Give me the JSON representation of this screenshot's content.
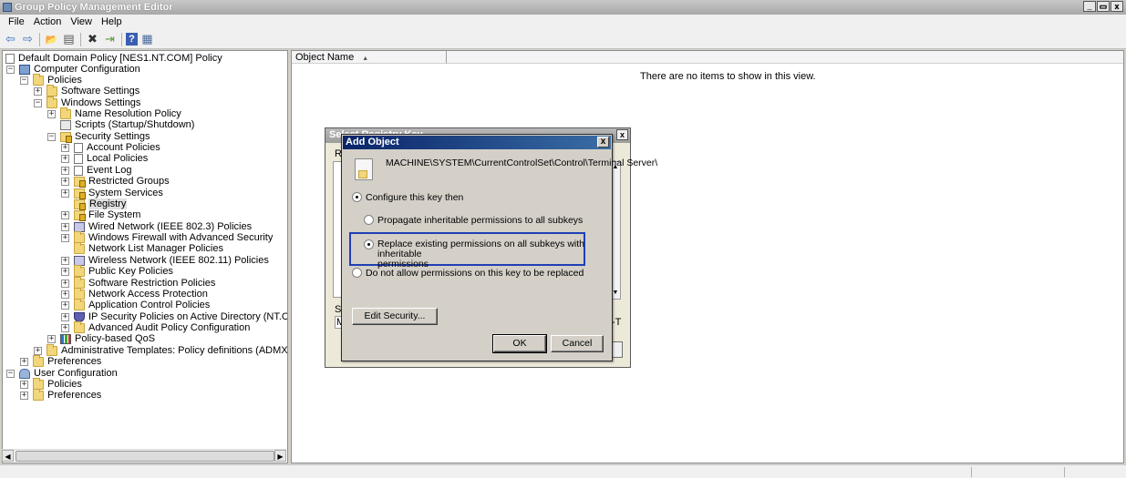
{
  "window": {
    "title": "Group Policy Management Editor",
    "controls": [
      "_",
      "▭",
      "x"
    ]
  },
  "menu": [
    "File",
    "Action",
    "View",
    "Help"
  ],
  "toolbar": {
    "icons": [
      "back-icon",
      "forward-icon",
      "up-folder-icon",
      "show-hide-tree-icon",
      "delete-icon",
      "export-list-icon",
      "help-icon",
      "properties-icon"
    ],
    "glyphs": [
      "⇦",
      "⇨",
      "📂",
      "▤",
      "✖",
      "⇥",
      "?",
      "▦"
    ]
  },
  "tree": {
    "root": "Default Domain Policy [NES1.NT.COM] Policy",
    "items": [
      {
        "label": "Computer Configuration"
      },
      {
        "label": "Policies"
      },
      {
        "label": "Software Settings"
      },
      {
        "label": "Windows Settings"
      },
      {
        "label": "Name Resolution Policy"
      },
      {
        "label": "Scripts (Startup/Shutdown)"
      },
      {
        "label": "Security Settings"
      },
      {
        "label": "Account Policies"
      },
      {
        "label": "Local Policies"
      },
      {
        "label": "Event Log"
      },
      {
        "label": "Restricted Groups"
      },
      {
        "label": "System Services"
      },
      {
        "label": "Registry"
      },
      {
        "label": "File System"
      },
      {
        "label": "Wired Network (IEEE 802.3) Policies"
      },
      {
        "label": "Windows Firewall with Advanced Security"
      },
      {
        "label": "Network List Manager Policies"
      },
      {
        "label": "Wireless Network (IEEE 802.11) Policies"
      },
      {
        "label": "Public Key Policies"
      },
      {
        "label": "Software Restriction Policies"
      },
      {
        "label": "Network Access Protection"
      },
      {
        "label": "Application Control Policies"
      },
      {
        "label": "IP Security Policies on Active Directory (NT.COM)"
      },
      {
        "label": "Advanced Audit Policy Configuration"
      },
      {
        "label": "Policy-based QoS"
      },
      {
        "label": "Administrative Templates: Policy definitions (ADMX files) retrieved fr"
      },
      {
        "label": "Preferences"
      },
      {
        "label": "User Configuration"
      },
      {
        "label": "Policies"
      },
      {
        "label": "Preferences"
      }
    ]
  },
  "list": {
    "column": "Object Name",
    "empty_message": "There are no items to show in this view."
  },
  "background_dialog": {
    "title": "Select Registry Key",
    "label1": "Re",
    "label2": "Se",
    "field_left": "M",
    "field_right": "-T",
    "close": "x"
  },
  "dialog": {
    "title": "Add Object",
    "close": "x",
    "object_path": "MACHINE\\SYSTEM\\CurrentControlSet\\Control\\Terminal Server\\",
    "configure_label": "Configure this key then",
    "propagate_label": "Propagate inheritable permissions to all subkeys",
    "replace_label_line1": "Replace existing permissions on all subkeys with inheritable",
    "replace_label_line2": "permissions",
    "no_replace_label": "Do not allow permissions on this key to be replaced",
    "edit_security": "Edit Security...",
    "ok": "OK",
    "cancel": "Cancel"
  }
}
